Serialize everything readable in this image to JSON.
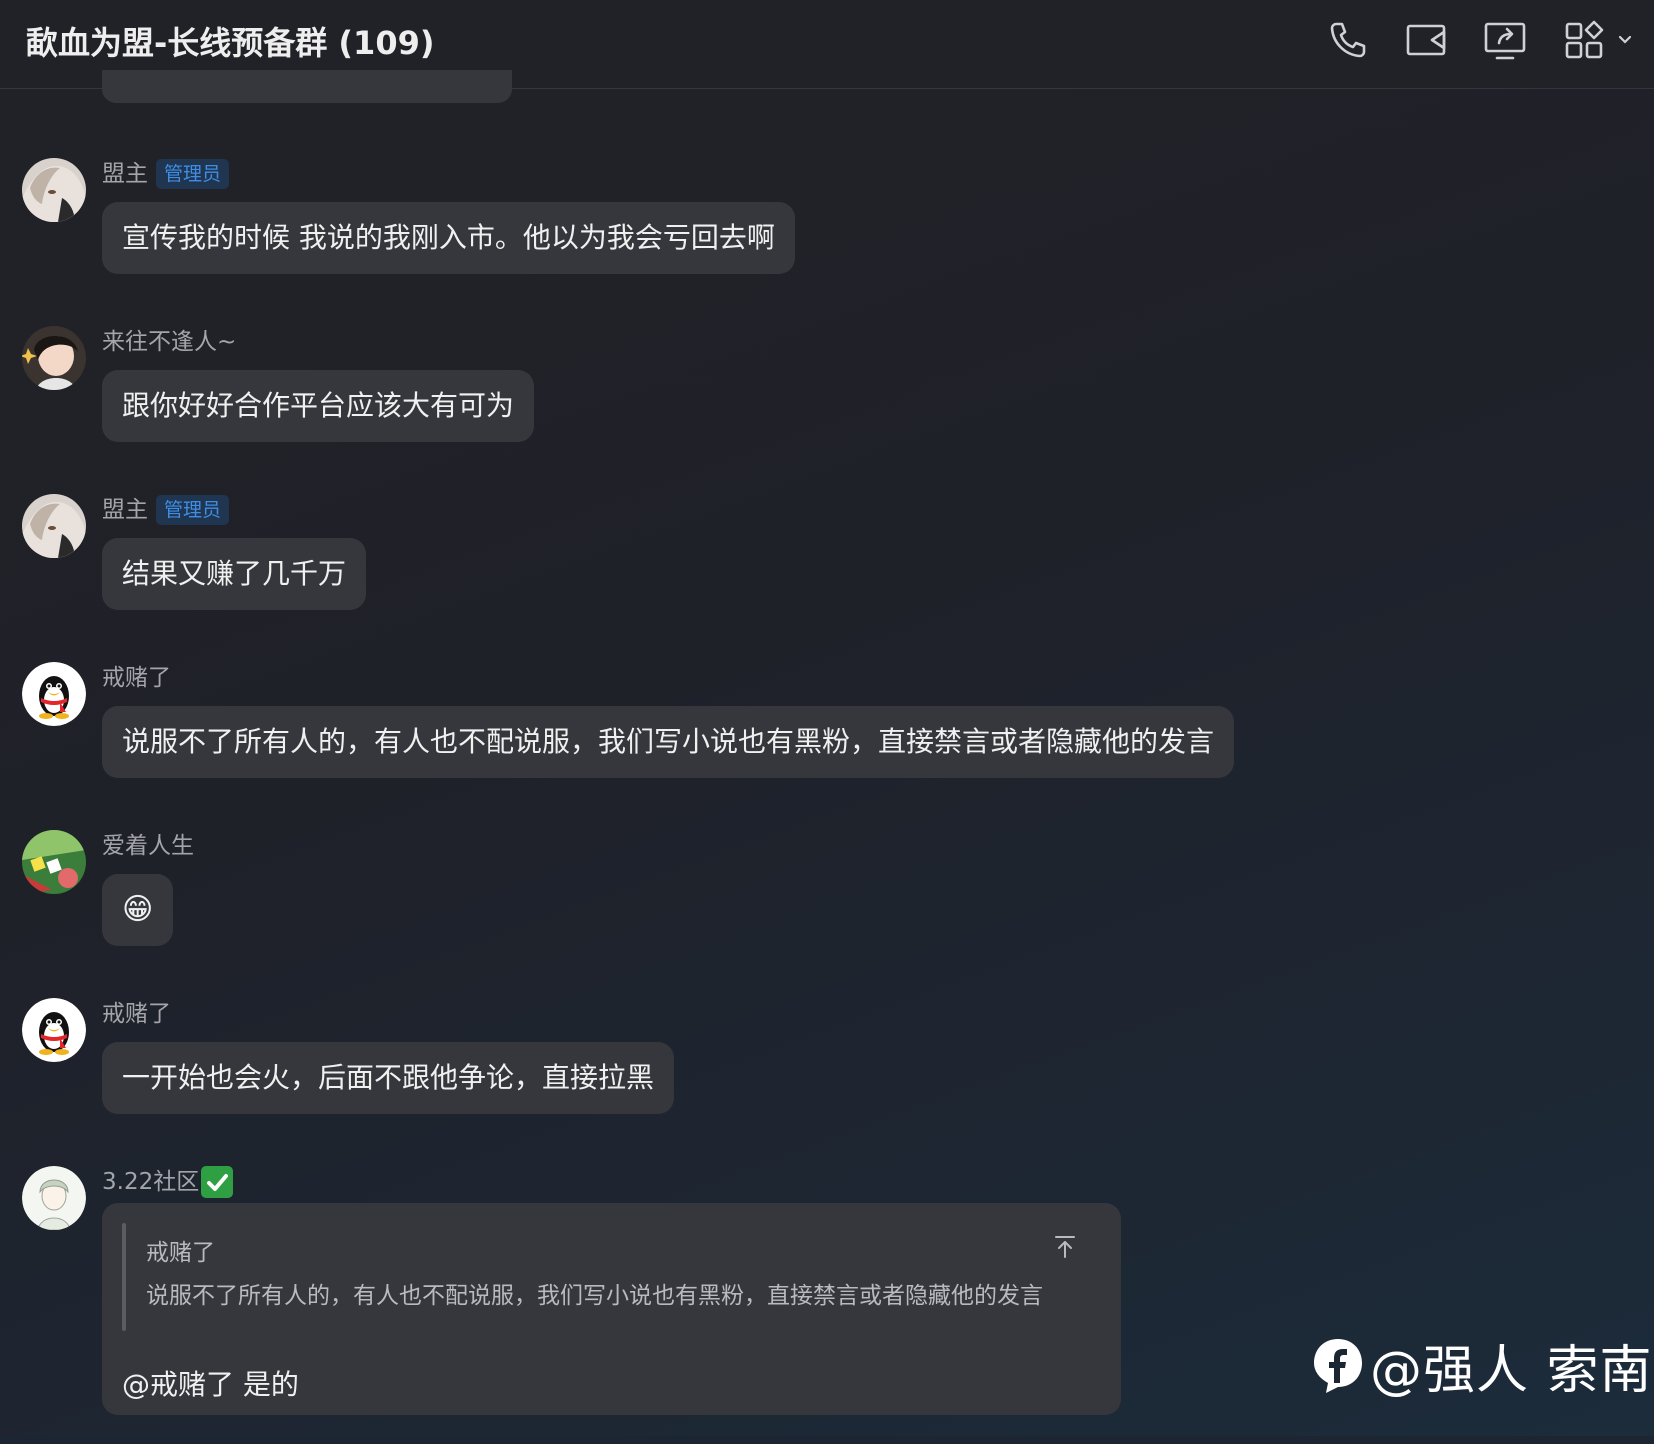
{
  "header": {
    "title": "歃血为盟-长线预备群 (109)",
    "icons": [
      "phone-icon",
      "video-call-icon",
      "screen-share-icon",
      "apps-grid-icon"
    ]
  },
  "messages": [
    {
      "sender": "盟主",
      "badge": "管理员",
      "text": "宣传我的时候 我说的我刚入市。他以为我会亏回去啊"
    },
    {
      "sender": "来往不逢人~",
      "text": "跟你好好合作平台应该大有可为"
    },
    {
      "sender": "盟主",
      "badge": "管理员",
      "text": "结果又赚了几千万"
    },
    {
      "sender": "戒赌了",
      "text": "说服不了所有人的，有人也不配说服，我们写小说也有黑粉，直接禁言或者隐藏他的发言"
    },
    {
      "sender": "爱着人生",
      "text": "😁"
    },
    {
      "sender": "戒赌了",
      "text": "一开始也会火，后面不跟他争论，直接拉黑"
    },
    {
      "sender": "3.22社区",
      "sender_icon": "check-mark-icon",
      "quote": {
        "name": "戒赌了",
        "text": "说服不了所有人的，有人也不配说服，我们写小说也有黑粉，直接禁言或者隐藏他的发言"
      },
      "text": "@戒赌了 是的"
    }
  ],
  "watermark": {
    "text": "@强人 索南"
  },
  "colors": {
    "background": "#212227",
    "bubble": "#36373c",
    "badge_text": "#3f8ee6",
    "badge_bg": "#1f3550",
    "check": "#2ea043"
  }
}
